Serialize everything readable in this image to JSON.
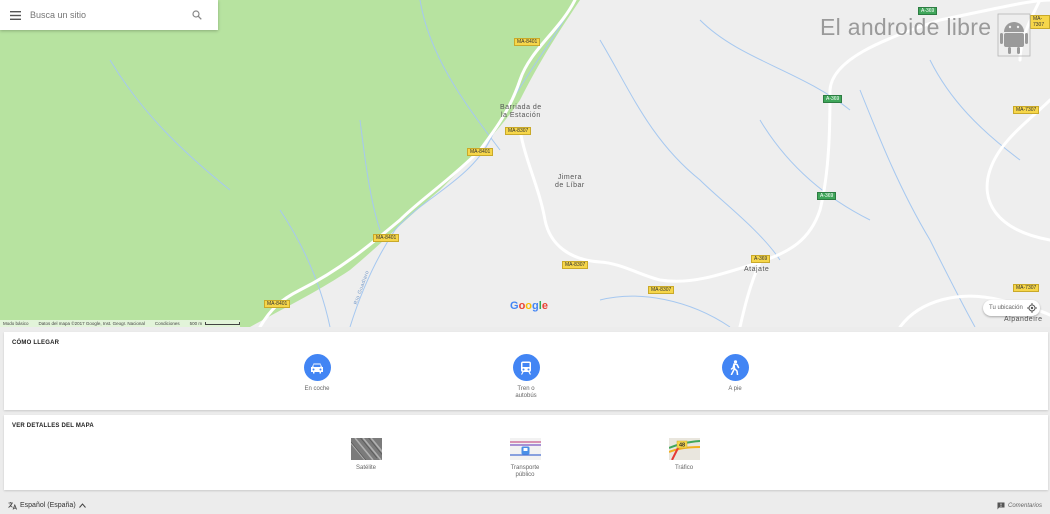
{
  "search": {
    "placeholder": "Busca un sitio"
  },
  "map": {
    "watermark": "El androide libre",
    "google_logo": "Google",
    "attribution": {
      "mode": "Modo básico",
      "data": "Datos del mapa ©2017 Google, Inst. Geogr. Nacional",
      "terms": "Condiciones",
      "scale": "500 m"
    },
    "my_location": "Tu ubicación",
    "places": [
      {
        "name": "Barriada de\nla Estación"
      },
      {
        "name": "Jimera\nde Líbar"
      },
      {
        "name": "Atajate"
      },
      {
        "name": "Alpandeire"
      }
    ],
    "river": "Río Guadiaro",
    "road_labels": [
      "MA-8401",
      "MA-8307",
      "MA-8401",
      "MA-8401",
      "MA-8401",
      "MA-8307",
      "MA-8307",
      "A-369",
      "A-369",
      "A-369",
      "A-369",
      "MA-7307",
      "MA-7307",
      "MA-7307"
    ]
  },
  "directions": {
    "title": "CÓMO LLEGAR",
    "modes": [
      {
        "label": "En coche",
        "icon": "car-icon"
      },
      {
        "label": "Tren o\nautobús",
        "icon": "train-icon"
      },
      {
        "label": "A pie",
        "icon": "walk-icon"
      }
    ]
  },
  "details": {
    "title": "VER DETALLES DEL MAPA",
    "layers": [
      {
        "label": "Satélite"
      },
      {
        "label": "Transporte\npúblico"
      },
      {
        "label": "Tráfico"
      }
    ],
    "traffic_badge": "48"
  },
  "footer": {
    "language": "Español (España)",
    "feedback": "Comentarios"
  },
  "colors": {
    "accent": "#4285f4",
    "park": "#b7e3a0",
    "road_yellow": "#f6d64a",
    "road_green": "#3fa65a"
  }
}
